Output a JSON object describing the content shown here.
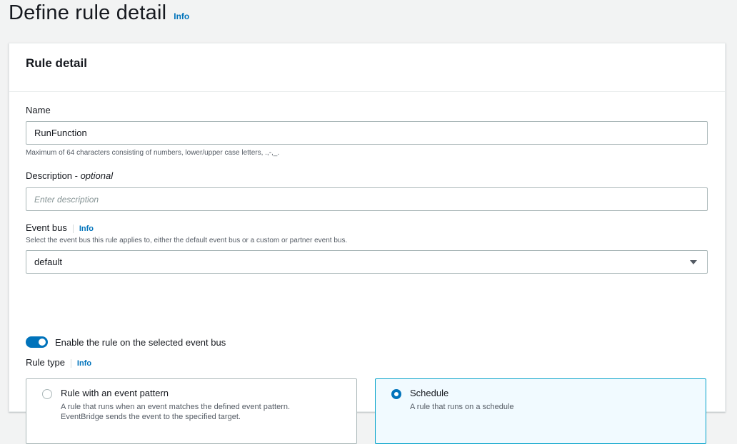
{
  "header": {
    "title": "Define rule detail",
    "info": "Info"
  },
  "panel": {
    "title": "Rule detail"
  },
  "name": {
    "label": "Name",
    "value": "RunFunction",
    "hint": "Maximum of 64 characters consisting of numbers, lower/upper case letters, .,-,_."
  },
  "description": {
    "label": "Description - ",
    "optional": "optional",
    "placeholder": "Enter description"
  },
  "event_bus": {
    "label": "Event bus",
    "info": "Info",
    "hint": "Select the event bus this rule applies to, either the default event bus or a custom or partner event bus.",
    "selected": "default"
  },
  "toggle": {
    "label": "Enable the rule on the selected event bus",
    "on": true
  },
  "rule_type": {
    "label": "Rule type",
    "info": "Info",
    "options": [
      {
        "title": "Rule with an event pattern",
        "desc": "A rule that runs when an event matches the defined event pattern. EventBridge sends the event to the specified target.",
        "selected": false
      },
      {
        "title": "Schedule",
        "desc": "A rule that runs on a schedule",
        "selected": true
      }
    ]
  },
  "colors": {
    "accent": "#0073bb",
    "selected_border": "#00a1c9",
    "selected_bg": "#f1faff"
  }
}
